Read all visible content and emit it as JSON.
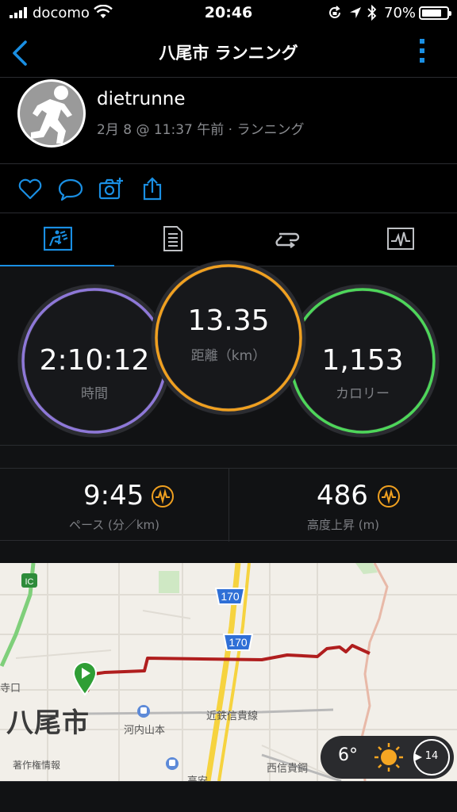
{
  "status_bar": {
    "carrier": "docomo",
    "time": "20:46",
    "battery_percent": "70%",
    "battery_level": 0.7
  },
  "header": {
    "title": "八尾市 ランニング",
    "accent_color": "#1a8fe3"
  },
  "profile": {
    "username": "dietrunne",
    "meta": "2月 8 @ 11:37 午前 · ランニング"
  },
  "actions": [
    "heart-icon",
    "comment-icon",
    "add-photo-icon",
    "share-icon"
  ],
  "tabs": [
    "summary-icon",
    "details-icon",
    "laps-icon",
    "graph-icon"
  ],
  "rings": {
    "time": {
      "value": "2:10:12",
      "label": "時間",
      "color": "#8e78d8"
    },
    "distance": {
      "value": "13.35",
      "label": "距離（km）",
      "color": "#f0a020"
    },
    "calories": {
      "value": "1,153",
      "label": "カロリー",
      "color": "#4ed65a"
    }
  },
  "stats": {
    "pace": {
      "value": "9:45",
      "label": "ペース (分／km)"
    },
    "elevation": {
      "value": "486",
      "label": "高度上昇 (m)"
    },
    "icon_color": "#f0a020"
  },
  "map": {
    "city": "八尾市",
    "station_1": "河内山本",
    "rail_line": "近鉄信貴線",
    "road_label": "西信貴鋼",
    "route_1": "170",
    "route_2": "170",
    "ic_label": "IC",
    "partial_label": "寺口",
    "copyright": "著作権情報",
    "station_2": "高安",
    "route_color": "#b01e1e"
  },
  "weather": {
    "temperature": "6°",
    "wind_speed": "14"
  }
}
